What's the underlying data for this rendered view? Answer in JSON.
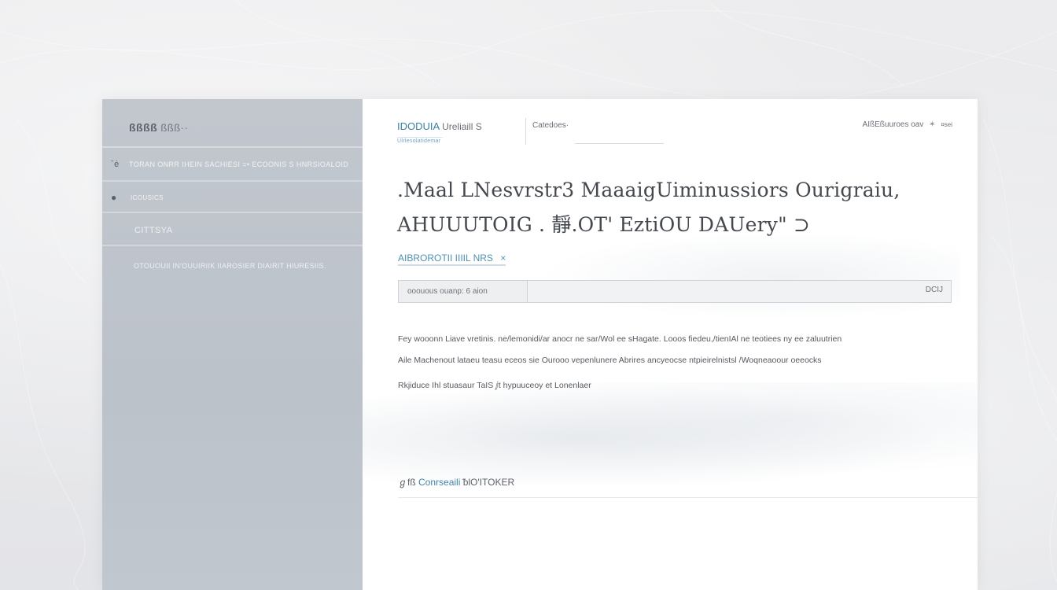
{
  "brand": {
    "name": "IDODUIA",
    "name_rest": "Ureliaill S",
    "tagline": "Ulrlesolatidemar"
  },
  "nav": {
    "categories": "Catedoes·"
  },
  "user_menu": {
    "label": "AIßEßuuroes oav",
    "extra": "¤sei"
  },
  "sidebar": {
    "logo_glyph": "ßßßß",
    "logo_text": "ßßß··",
    "items": [
      {
        "icon": "info-icon",
        "label": "TORAN ONRR IHEIN SACHIESI =• ECOONIS S HNRSIOALOID"
      },
      {
        "icon": "apple-icon",
        "label": "ICOUSICS"
      },
      {
        "icon": "",
        "label": "CITTSYA"
      }
    ],
    "note": "OTOUOUII IN'OUUIRIIK IIAROSIER DIAIRIT HIURESIIS."
  },
  "page": {
    "title_line1": ".Maal LNesvrstr3 MaaaigUiminussiors Ourigraiu,",
    "title_line2": "AHUUUTOIG . 靜.OT' EztiOU DAUery\" ⊃"
  },
  "section_link": {
    "label": "AIBROROTII IIIIL NRS",
    "close": "×"
  },
  "search": {
    "prefix": "ooouous ouanp: 6 aion",
    "value": "",
    "placeholder": "",
    "button": "DCIJ"
  },
  "body": {
    "line1": "Fey wooonn Liave vretinis. ne/lemonidi/ar anocr ne sar/Wol ee sHagate. Looos fiedeu,/tienIAl ne teotiees ny ee zaluutrien",
    "line2": "Aile Machenout lataeu teasu eceos sie Ourooo vepenlunere Abrires ancyeocse ntpieirelnistsl /Woqneaoour oeeocks",
    "note": "Rkjiduce Ihl stuasaur TaIS  ⅉt hypuuceoy et Lonenlaer"
  },
  "content_section": {
    "icon_text": "ℊfß",
    "accent": "Conrseaili",
    "rest": "ᵬlO'ITOKER"
  }
}
